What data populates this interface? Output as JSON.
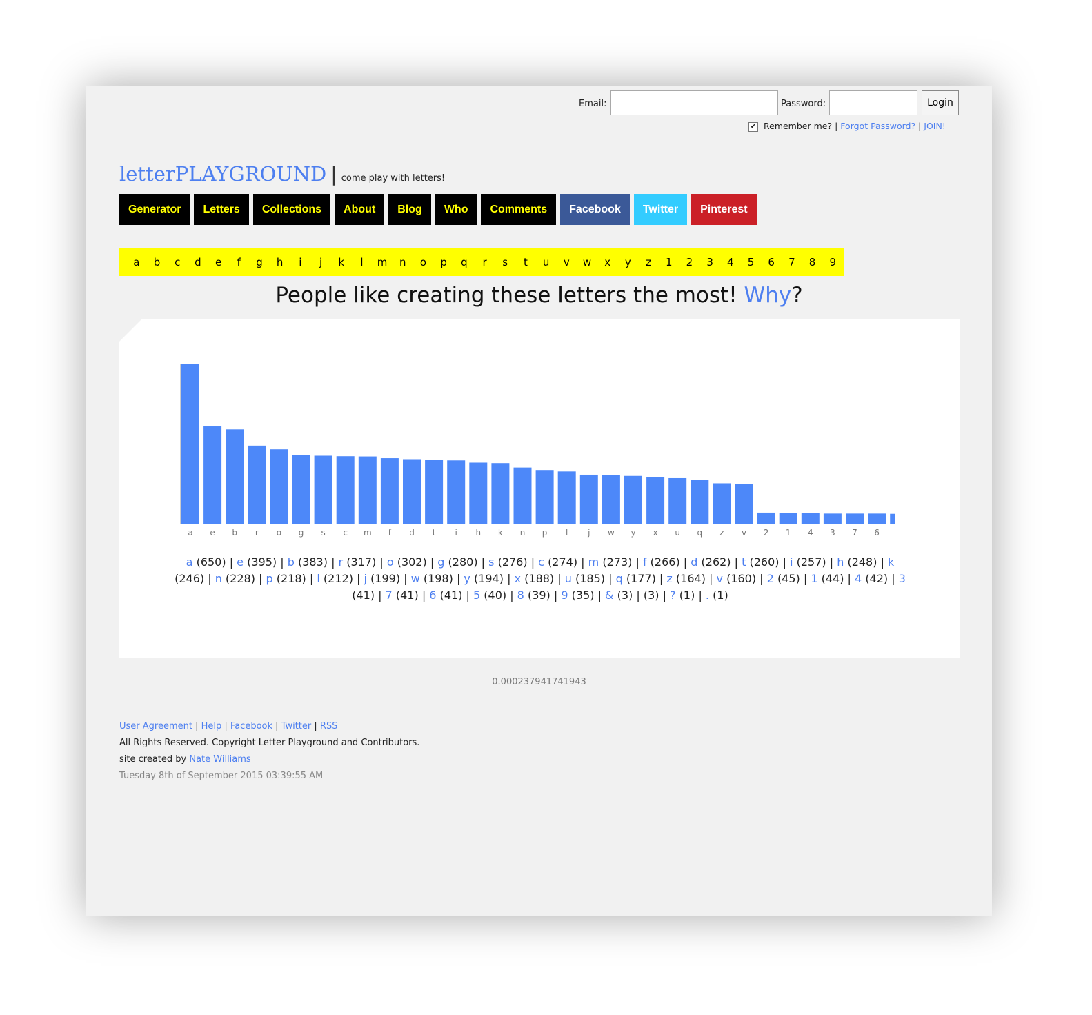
{
  "login": {
    "email_label": "Email:",
    "password_label": "Password:",
    "email_value": "",
    "password_value": "",
    "login_button": "Login",
    "remember_checked": true,
    "remember_label": "Remember me?",
    "separator": "|",
    "forgot_link": "Forgot Password?",
    "join_link": "JOIN!"
  },
  "brand": {
    "name": "letterPLAYGROUND",
    "separator": "|",
    "tagline": "come play with letters!"
  },
  "nav": [
    {
      "label": "Generator",
      "color": "#ffff00",
      "bg": "#000000"
    },
    {
      "label": "Letters",
      "color": "#ffff00",
      "bg": "#000000"
    },
    {
      "label": "Collections",
      "color": "#ffff00",
      "bg": "#000000"
    },
    {
      "label": "About",
      "color": "#ffff00",
      "bg": "#000000"
    },
    {
      "label": "Blog",
      "color": "#ffff00",
      "bg": "#000000"
    },
    {
      "label": "Who",
      "color": "#ffff00",
      "bg": "#000000"
    },
    {
      "label": "Comments",
      "color": "#ffff00",
      "bg": "#000000"
    },
    {
      "label": "Facebook",
      "color": "#ffffff",
      "bg": "#3b5998"
    },
    {
      "label": "Twitter",
      "color": "#ffffff",
      "bg": "#33ccff"
    },
    {
      "label": "Pinterest",
      "color": "#ffffff",
      "bg": "#cb2027"
    }
  ],
  "alphabet": [
    "a",
    "b",
    "c",
    "d",
    "e",
    "f",
    "g",
    "h",
    "i",
    "j",
    "k",
    "l",
    "m",
    "n",
    "o",
    "p",
    "q",
    "r",
    "s",
    "t",
    "u",
    "v",
    "w",
    "x",
    "y",
    "z",
    "1",
    "2",
    "3",
    "4",
    "5",
    "6",
    "7",
    "8",
    "9"
  ],
  "headline": {
    "text": "People like creating these letters the most!",
    "why_link": "Why",
    "suffix": "?"
  },
  "chart_data": {
    "type": "bar",
    "categories": [
      "a",
      "e",
      "b",
      "r",
      "o",
      "g",
      "s",
      "c",
      "m",
      "f",
      "d",
      "t",
      "i",
      "h",
      "k",
      "n",
      "p",
      "l",
      "j",
      "w",
      "y",
      "x",
      "u",
      "q",
      "z",
      "v",
      "2",
      "1",
      "4",
      "3",
      "7",
      "6"
    ],
    "values": [
      650,
      395,
      383,
      317,
      302,
      280,
      276,
      274,
      273,
      266,
      262,
      260,
      257,
      248,
      246,
      228,
      218,
      212,
      199,
      198,
      194,
      188,
      185,
      177,
      164,
      160,
      45,
      44,
      42,
      41,
      41,
      41
    ],
    "partial_last_value": 40,
    "bar_color": "#4d88f9",
    "ylim": [
      0,
      650
    ],
    "grid": false,
    "legend": "none"
  },
  "counts": [
    {
      "ch": "a",
      "n": "(650)"
    },
    {
      "ch": "e",
      "n": "(395)"
    },
    {
      "ch": "b",
      "n": "(383)"
    },
    {
      "ch": "r",
      "n": "(317)"
    },
    {
      "ch": "o",
      "n": "(302)"
    },
    {
      "ch": "g",
      "n": "(280)"
    },
    {
      "ch": "s",
      "n": "(276)"
    },
    {
      "ch": "c",
      "n": "(274)"
    },
    {
      "ch": "m",
      "n": "(273)"
    },
    {
      "ch": "f",
      "n": "(266)"
    },
    {
      "ch": "d",
      "n": "(262)"
    },
    {
      "ch": "t",
      "n": "(260)"
    },
    {
      "ch": "i",
      "n": "(257)"
    },
    {
      "ch": "h",
      "n": "(248)"
    },
    {
      "ch": "k",
      "n": "(246)"
    },
    {
      "ch": "n",
      "n": "(228)"
    },
    {
      "ch": "p",
      "n": "(218)"
    },
    {
      "ch": "l",
      "n": "(212)"
    },
    {
      "ch": "j",
      "n": "(199)"
    },
    {
      "ch": "w",
      "n": "(198)"
    },
    {
      "ch": "y",
      "n": "(194)"
    },
    {
      "ch": "x",
      "n": "(188)"
    },
    {
      "ch": "u",
      "n": "(185)"
    },
    {
      "ch": "q",
      "n": "(177)"
    },
    {
      "ch": "z",
      "n": "(164)"
    },
    {
      "ch": "v",
      "n": "(160)"
    },
    {
      "ch": "2",
      "n": "(45)"
    },
    {
      "ch": "1",
      "n": "(44)"
    },
    {
      "ch": "4",
      "n": "(42)"
    },
    {
      "ch": "3",
      "n": "(41)"
    },
    {
      "ch": "7",
      "n": "(41)"
    },
    {
      "ch": "6",
      "n": "(41)"
    },
    {
      "ch": "5",
      "n": "(40)"
    },
    {
      "ch": "8",
      "n": "(39)"
    },
    {
      "ch": "9",
      "n": "(35)"
    },
    {
      "ch": "&",
      "n": "(3)"
    },
    {
      "ch": "",
      "n": "(3)"
    },
    {
      "ch": "?",
      "n": "(1)"
    },
    {
      "ch": ".",
      "n": "(1)"
    }
  ],
  "timing": "0.000237941741943",
  "footer": {
    "links": [
      "User Agreement",
      "Help",
      "Facebook",
      "Twitter",
      "RSS"
    ],
    "rights": "All Rights Reserved. Copyright Letter Playground and Contributors.",
    "created_prefix": "site created by",
    "author": "Nate Williams",
    "date": "Tuesday 8th of September 2015 03:39:55 AM"
  },
  "colors": {
    "accent": "#4d7ff0",
    "highlight": "#ffff00",
    "background": "#f1f1f1"
  }
}
